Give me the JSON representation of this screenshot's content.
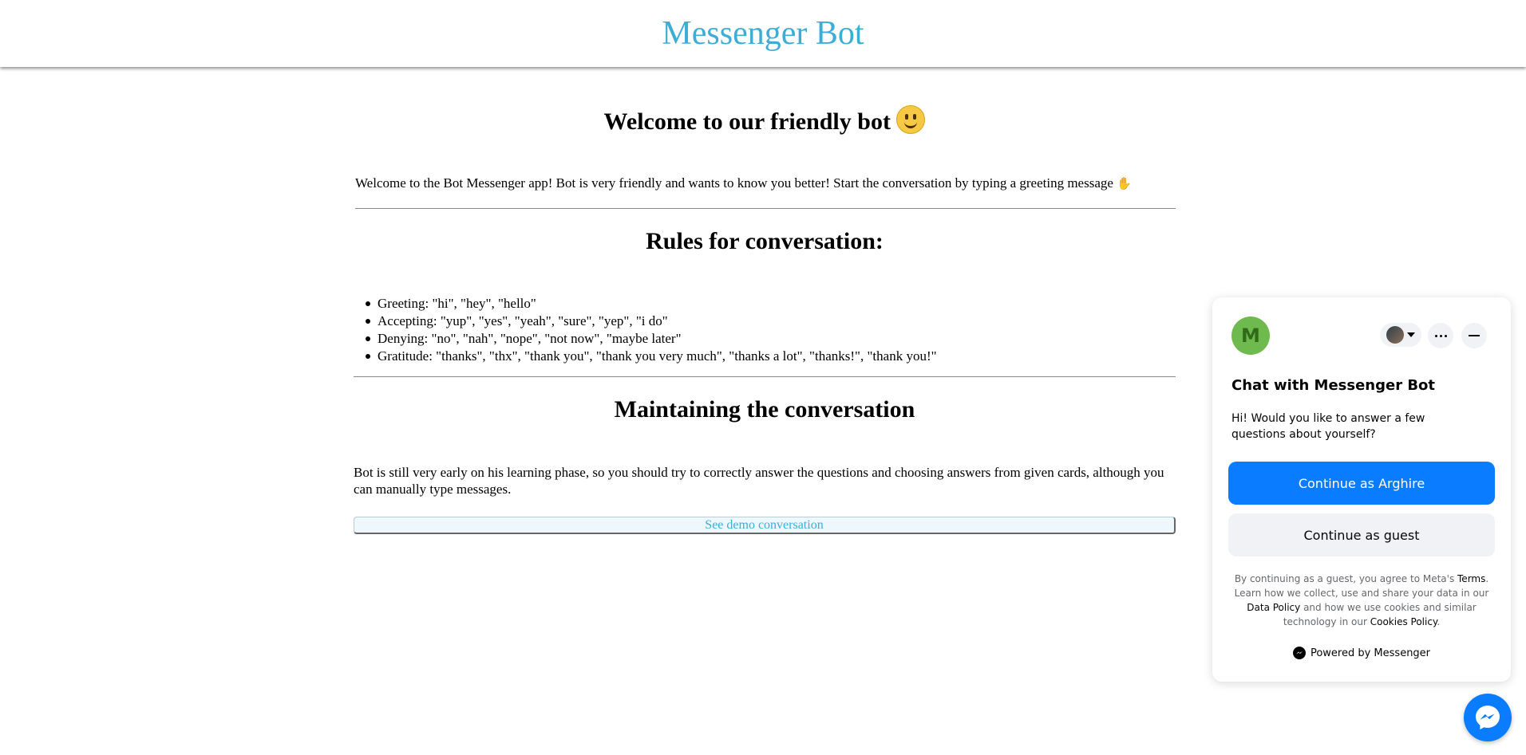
{
  "header": {
    "title": "Messenger Bot"
  },
  "main": {
    "welcome_title": "Welcome to our friendly bot",
    "intro": "Welcome to the Bot Messenger app! Bot is very friendly and wants to know you better! Start the conversation by typing a greeting message",
    "rules_title": "Rules for conversation:",
    "rules": [
      "Greeting: \"hi\", \"hey\", \"hello\"",
      "Accepting: \"yup\", \"yes\", \"yeah\", \"sure\", \"yep\", \"i do\"",
      "Denying: \"no\", \"nah\", \"nope\", \"not now\", \"maybe later\"",
      "Gratitude: \"thanks\", \"thx\", \"thank you\", \"thank you very much\", \"thanks a lot\", \"thanks!\", \"thank you!\""
    ],
    "maintaining_title": "Maintaining the conversation",
    "maintaining_text": "Bot is still very early on his learning phase, so you should try to correctly answer the questions and choosing answers from given cards, although you can manually type messages.",
    "demo_button": "See demo conversation"
  },
  "chat_widget": {
    "avatar_letter": "M",
    "title": "Chat with Messenger Bot",
    "subtitle": "Hi! Would you like to answer a few questions about yourself?",
    "continue_as_user": "Continue as Arghire",
    "continue_as_guest": "Continue as guest",
    "legal_1": "By continuing as a guest, you agree to Meta's ",
    "legal_terms": "Terms",
    "legal_2": ". Learn how we collect, use and share your data in our ",
    "legal_data_policy": "Data Policy",
    "legal_3": " and how we use cookies and similar technology in our ",
    "legal_cookies": "Cookies Policy",
    "legal_4": ".",
    "powered_by": "Powered by Messenger",
    "accent_color": "#0a7cff"
  },
  "colors": {
    "brand": "#3eadd6",
    "avatar": "#6fba4f"
  }
}
